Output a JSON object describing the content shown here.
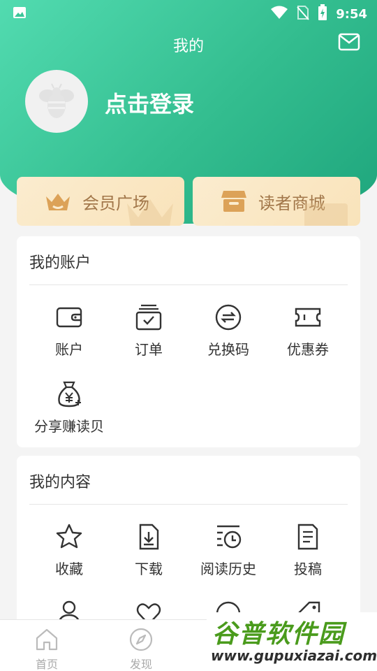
{
  "status_bar": {
    "time": "9:54"
  },
  "header": {
    "title": "我的",
    "login_text": "点击登录"
  },
  "promos": [
    {
      "label": "会员广场",
      "icon": "crown-icon"
    },
    {
      "label": "读者商城",
      "icon": "store-icon"
    }
  ],
  "account": {
    "title": "我的账户",
    "items": [
      {
        "label": "账户",
        "icon": "wallet-icon"
      },
      {
        "label": "订单",
        "icon": "order-icon"
      },
      {
        "label": "兑换码",
        "icon": "exchange-icon"
      },
      {
        "label": "优惠券",
        "icon": "coupon-icon"
      },
      {
        "label": "分享赚读贝",
        "icon": "money-bag-icon"
      }
    ]
  },
  "content": {
    "title": "我的内容",
    "items": [
      {
        "label": "收藏",
        "icon": "star-icon"
      },
      {
        "label": "下载",
        "icon": "download-icon"
      },
      {
        "label": "阅读历史",
        "icon": "history-icon"
      },
      {
        "label": "投稿",
        "icon": "document-icon"
      }
    ]
  },
  "bottom_nav": [
    {
      "label": "首页",
      "icon": "home-icon"
    },
    {
      "label": "发现",
      "icon": "compass-icon"
    }
  ],
  "watermark": {
    "title": "谷普软件园",
    "url": "www.gupuxiazai.com"
  },
  "colors": {
    "accent": "#33bd8f",
    "promo_text": "#a2774a",
    "promo_bg": "#fbeccf"
  }
}
